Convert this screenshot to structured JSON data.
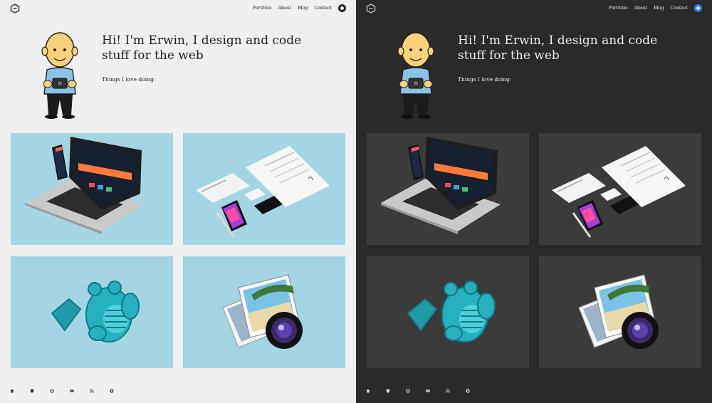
{
  "nav": {
    "items": [
      {
        "label": "Portfolio"
      },
      {
        "label": "About"
      },
      {
        "label": "Blog"
      },
      {
        "label": "Contact"
      }
    ]
  },
  "hero": {
    "headline": "Hi! I'm Erwin, I design and code stuff for the web",
    "subline": "Things I love doing:"
  },
  "footer": {
    "icons": [
      "home-icon",
      "shield-icon",
      "globe-icon",
      "youtube-icon",
      "rss-icon",
      "github-icon"
    ]
  },
  "colors": {
    "light_bg": "#efefef",
    "dark_bg": "#2a2a2a",
    "tile_light": "#a3d5e2",
    "tile_dark": "#3b3b3b",
    "toggle_dark_accent": "#2b7fe0",
    "mascot_teal": "#26b0bd"
  }
}
